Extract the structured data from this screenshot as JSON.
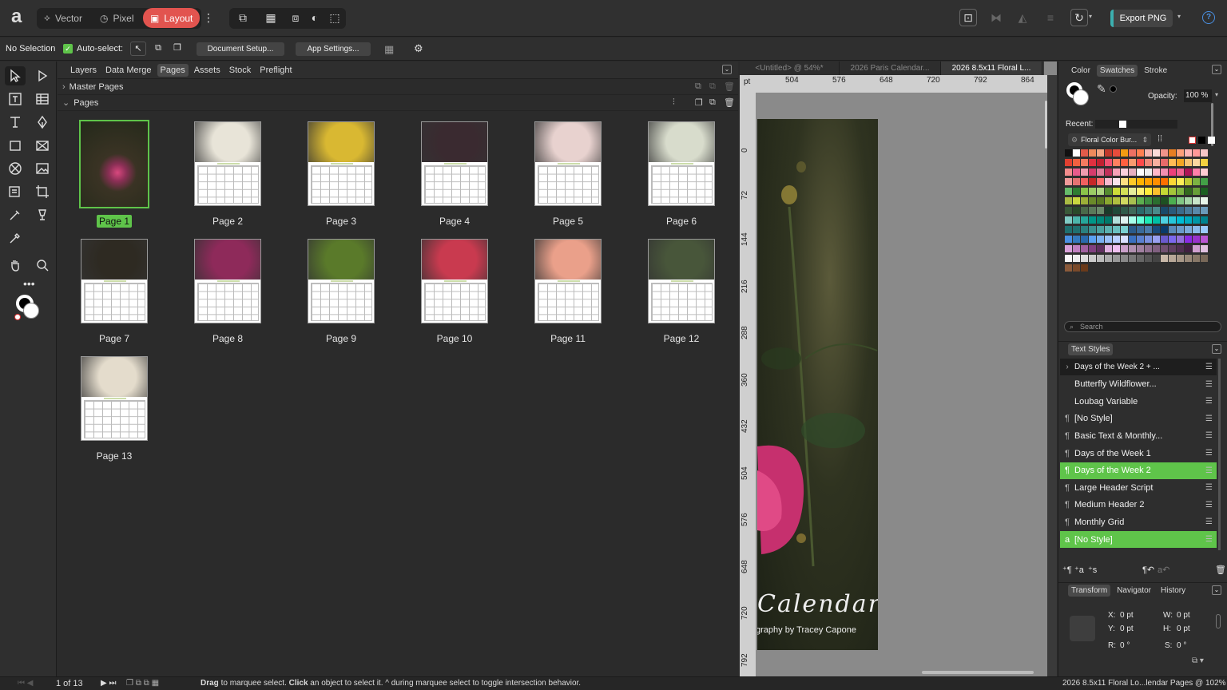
{
  "topbar": {
    "personas": {
      "vector": "Vector",
      "pixel": "Pixel",
      "layout": "Layout"
    },
    "export_label": "Export PNG"
  },
  "context": {
    "selection": "No Selection",
    "auto_select": "Auto-select:",
    "document_setup": "Document Setup...",
    "app_settings": "App Settings..."
  },
  "pages_panel": {
    "tabs": [
      "Layers",
      "Data Merge",
      "Pages",
      "Assets",
      "Stock",
      "Preflight"
    ],
    "active_tab": "Pages",
    "master_pages": "Master Pages",
    "pages_header": "Pages",
    "pages": [
      {
        "label": "Page 1",
        "selected": true,
        "photo": "#4a2a3a"
      },
      {
        "label": "Page 2",
        "selected": false,
        "photo": "#e8e4d8"
      },
      {
        "label": "Page 3",
        "selected": false,
        "photo": "#d9b832"
      },
      {
        "label": "Page 4",
        "selected": false,
        "photo": "#3a2a30"
      },
      {
        "label": "Page 5",
        "selected": false,
        "photo": "#e8d2cf"
      },
      {
        "label": "Page 6",
        "selected": false,
        "photo": "#d8dccc"
      },
      {
        "label": "Page 7",
        "selected": false,
        "photo": "#2e2a22"
      },
      {
        "label": "Page 8",
        "selected": false,
        "photo": "#8e2a5a"
      },
      {
        "label": "Page 9",
        "selected": false,
        "photo": "#5a7a2a"
      },
      {
        "label": "Page 10",
        "selected": false,
        "photo": "#c93a4f"
      },
      {
        "label": "Page 11",
        "selected": false,
        "photo": "#eaa08a"
      },
      {
        "label": "Page 12",
        "selected": false,
        "photo": "#48563a"
      },
      {
        "label": "Page 13",
        "selected": false,
        "photo": "#e4dccc"
      }
    ]
  },
  "document": {
    "tabs": [
      "<Untitled> @ 54%*",
      "2026 Paris Calendar...",
      "2026 8.5x11 Floral L..."
    ],
    "ruler_unit": "pt",
    "h_ticks": [
      "504",
      "576",
      "648",
      "720",
      "792",
      "864"
    ],
    "v_ticks": [
      "0",
      "72",
      "144",
      "216",
      "288",
      "360",
      "432",
      "504",
      "576",
      "648",
      "720",
      "792"
    ],
    "page_title": "Calendar",
    "page_credit": "graphy by Tracey Capone"
  },
  "right_panel": {
    "tabs": [
      "Color",
      "Swatches",
      "Stroke"
    ],
    "active_tab": "Swatches",
    "opacity_label": "Opacity:",
    "opacity_value": "100 %",
    "recent_label": "Recent:",
    "palette_name": "Floral Color Bur...",
    "search_placeholder": "Search",
    "text_styles_tab": "Text Styles",
    "text_styles": [
      {
        "label": "Days of the Week 2 + ...",
        "mark": "›",
        "highlight": false
      },
      {
        "label": "Butterfly Wildflower...",
        "mark": "",
        "highlight": false
      },
      {
        "label": "Loubag Variable",
        "mark": "",
        "highlight": false
      },
      {
        "label": "[No Style]",
        "mark": "¶",
        "highlight": false
      },
      {
        "label": "Basic Text & Monthly...",
        "mark": "¶",
        "highlight": false
      },
      {
        "label": "Days of the Week 1",
        "mark": "¶",
        "highlight": false
      },
      {
        "label": "Days of the Week 2",
        "mark": "¶",
        "highlight": true
      },
      {
        "label": "Large Header Script",
        "mark": "¶",
        "highlight": false
      },
      {
        "label": "Medium Header 2",
        "mark": "¶",
        "highlight": false
      },
      {
        "label": "Monthly Grid",
        "mark": "¶",
        "highlight": false
      },
      {
        "label": "[No Style]",
        "mark": "a",
        "highlight": true
      }
    ],
    "transform_tabs": [
      "Transform",
      "Navigator",
      "History"
    ],
    "transform_active": "Transform",
    "x_label": "X:",
    "x_value": "0 pt",
    "y_label": "Y:",
    "y_value": "0 pt",
    "w_label": "W:",
    "w_value": "0 pt",
    "h_label": "H:",
    "h_value": "0 pt",
    "r_label": "R:",
    "r_value": "0 °",
    "s_label": "S:",
    "s_value": "0 °"
  },
  "status": {
    "page_of": "1 of 13",
    "hint_drag": "Drag",
    "hint_1": " to marquee select. ",
    "hint_click": "Click",
    "hint_2": " an object to select it. ^ during marquee select to toggle intersection behavior.",
    "doc_info": "2026 8.5x11 Floral Lo...lendar Pages @ 102%"
  },
  "colors": {
    "accent_green": "#5fc44a",
    "layout_red": "#e2544f",
    "export_teal": "#3cb0b0"
  }
}
